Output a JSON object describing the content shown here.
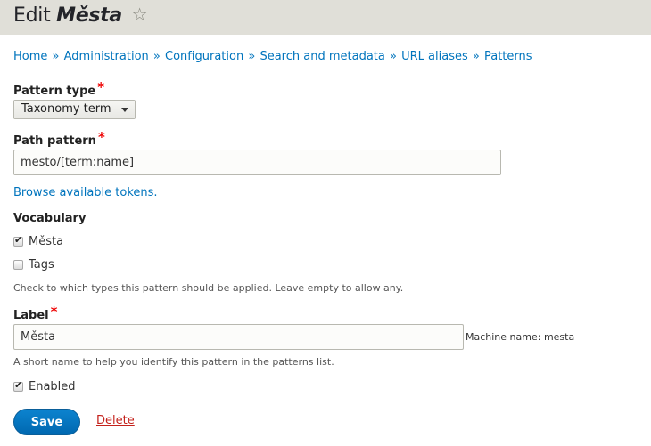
{
  "header": {
    "title_prefix": "Edit",
    "title_entity": "Města",
    "star_icon": "star-outline-icon"
  },
  "breadcrumb": {
    "items": [
      "Home",
      "Administration",
      "Configuration",
      "Search and metadata",
      "URL aliases",
      "Patterns"
    ],
    "separator": "»"
  },
  "form": {
    "pattern_type": {
      "label": "Pattern type",
      "required_marker": "*",
      "selected": "Taxonomy term"
    },
    "path_pattern": {
      "label": "Path pattern",
      "required_marker": "*",
      "value": "mesto/[term:name]"
    },
    "browse_tokens_link": "Browse available tokens.",
    "vocabulary": {
      "label": "Vocabulary",
      "options": [
        {
          "label": "Města",
          "checked": true
        },
        {
          "label": "Tags",
          "checked": false
        }
      ],
      "description": "Check to which types this pattern should be applied. Leave empty to allow any."
    },
    "label_field": {
      "label": "Label",
      "required_marker": "*",
      "value": "Města",
      "machine_name": "Machine name: mesta",
      "description": "A short name to help you identify this pattern in the patterns list."
    },
    "enabled": {
      "label": "Enabled",
      "checked": true
    },
    "actions": {
      "save_label": "Save",
      "delete_label": "Delete"
    }
  },
  "colors": {
    "header_bg": "#e0dfd8",
    "link": "#0074bd",
    "required": "#ee0000",
    "primary_button": "#0074bd",
    "danger_link": "#c4211b"
  }
}
